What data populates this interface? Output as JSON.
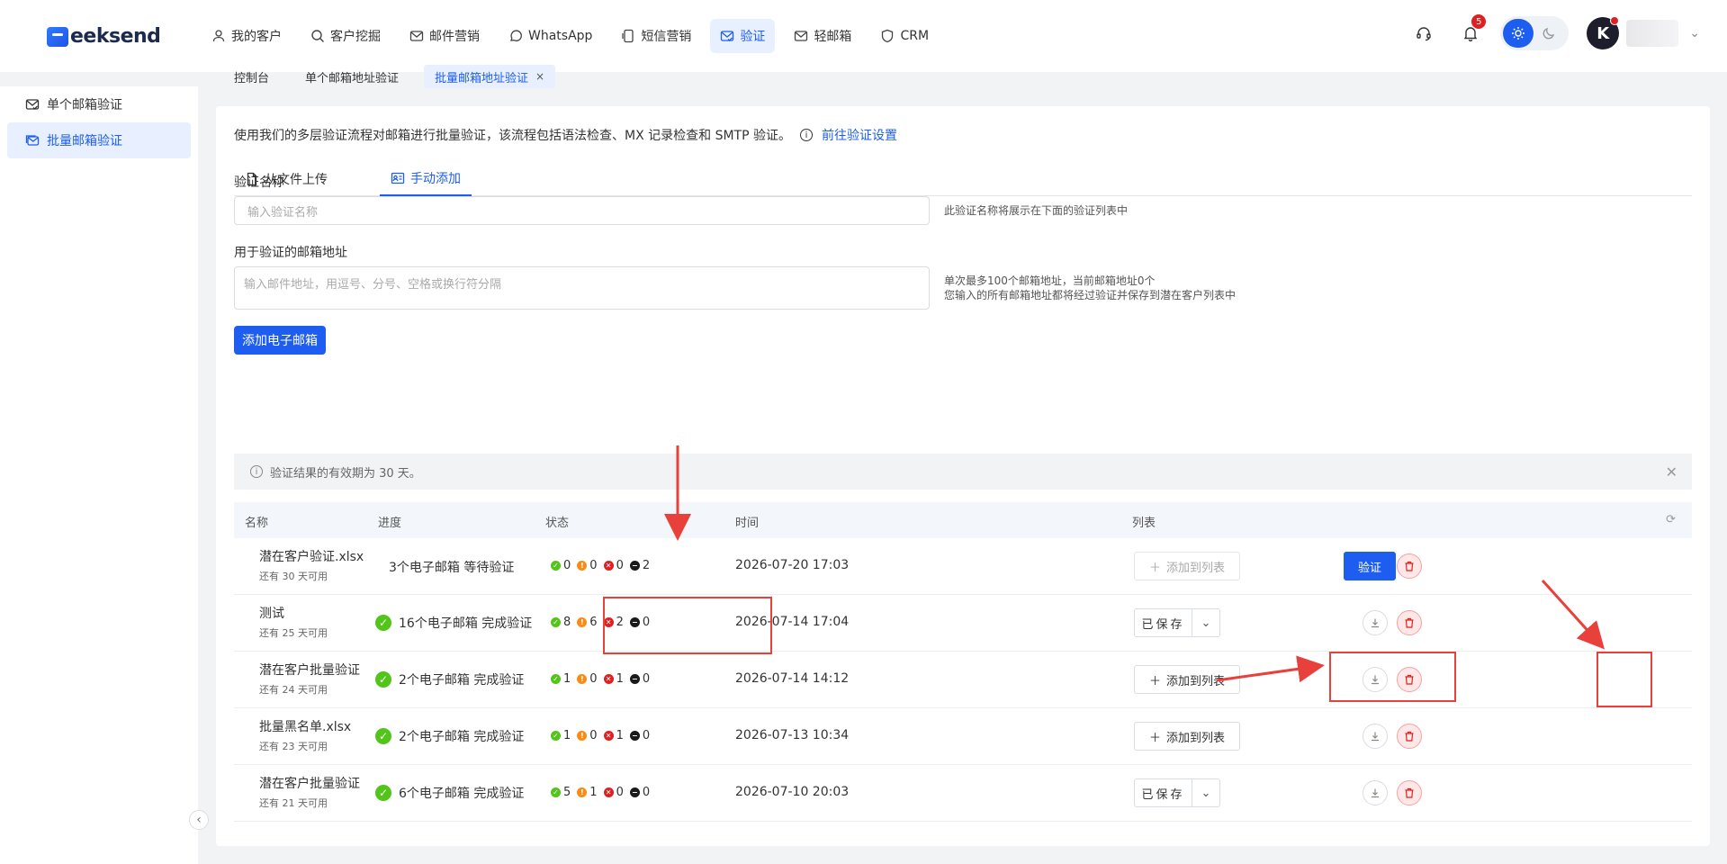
{
  "brand": {
    "logo_text": "eeksend"
  },
  "nav": [
    {
      "label": "我的客户",
      "icon": "user-icon"
    },
    {
      "label": "客户挖掘",
      "icon": "search-icon"
    },
    {
      "label": "邮件营销",
      "icon": "mail-icon"
    },
    {
      "label": "WhatsApp",
      "icon": "whatsapp-icon"
    },
    {
      "label": "短信营销",
      "icon": "sms-icon"
    },
    {
      "label": "验证",
      "icon": "mail-check-icon",
      "active": true
    },
    {
      "label": "轻邮箱",
      "icon": "light-mail-icon"
    },
    {
      "label": "CRM",
      "icon": "shield-icon"
    }
  ],
  "header": {
    "notification_count": "5",
    "avatar_letter": "K"
  },
  "subtabs": [
    {
      "label": "控制台"
    },
    {
      "label": "单个邮箱地址验证"
    },
    {
      "label": "批量邮箱地址验证",
      "active": true,
      "close": "×"
    }
  ],
  "sidebar": [
    {
      "label": "单个邮箱验证",
      "icon": "mail-check-icon"
    },
    {
      "label": "批量邮箱验证",
      "icon": "mail-batch-icon",
      "active": true
    }
  ],
  "main": {
    "description": "使用我们的多层验证流程对邮箱进行批量验证，该流程包括语法检查、MX 记录检查和 SMTP 验证。",
    "settings_link": "前往验证设置",
    "tabs": [
      {
        "label": "从文件上传",
        "icon": "file-icon"
      },
      {
        "label": "手动添加",
        "icon": "contact-card-icon",
        "active": true
      }
    ],
    "name_label": "验证名称",
    "name_placeholder": "输入验证名称",
    "name_hint": "此验证名称将展示在下面的验证列表中",
    "emails_label": "用于验证的邮箱地址",
    "emails_placeholder": "输入邮件地址，用逗号、分号、空格或换行符分隔",
    "emails_hint_1": "单次最多100个邮箱地址，当前邮箱地址0个",
    "emails_hint_2": "您输入的所有邮箱地址都将经过验证并保存到潜在客户列表中",
    "add_button": "添加电子邮箱",
    "notice": "验证结果的有效期为 30 天。"
  },
  "table": {
    "headers": {
      "name": "名称",
      "progress": "进度",
      "status": "状态",
      "time": "时间",
      "list": "列表"
    },
    "rows": [
      {
        "name": "潜在客户验证.xlsx",
        "sub": "还有 30 天可用",
        "progress": "3个电子邮箱 等待验证",
        "done": false,
        "ok": "0",
        "warn": "0",
        "bad": "0",
        "unk": "2",
        "time": "2026-07-20 17:03",
        "list_action": "添加到列表",
        "list_disabled": true,
        "verify": "验证"
      },
      {
        "name": "测试",
        "sub": "还有 25 天可用",
        "progress": "16个电子邮箱 完成验证",
        "done": true,
        "ok": "8",
        "warn": "6",
        "bad": "2",
        "unk": "0",
        "time": "2026-07-14 17:04",
        "saved": "已保存"
      },
      {
        "name": "潜在客户批量验证",
        "sub": "还有 24 天可用",
        "progress": "2个电子邮箱 完成验证",
        "done": true,
        "ok": "1",
        "warn": "0",
        "bad": "1",
        "unk": "0",
        "time": "2026-07-14 14:12",
        "list_action": "添加到列表"
      },
      {
        "name": "批量黑名单.xlsx",
        "sub": "还有 23 天可用",
        "progress": "2个电子邮箱 完成验证",
        "done": true,
        "ok": "1",
        "warn": "0",
        "bad": "1",
        "unk": "0",
        "time": "2026-07-13 10:34",
        "list_action": "添加到列表"
      },
      {
        "name": "潜在客户批量验证",
        "sub": "还有 21 天可用",
        "progress": "6个电子邮箱 完成验证",
        "done": true,
        "ok": "5",
        "warn": "1",
        "bad": "0",
        "unk": "0",
        "time": "2026-07-10 20:03",
        "saved": "已保存"
      }
    ]
  },
  "colors": {
    "accent": "#1d5df0",
    "annotation": "#e8403a"
  }
}
